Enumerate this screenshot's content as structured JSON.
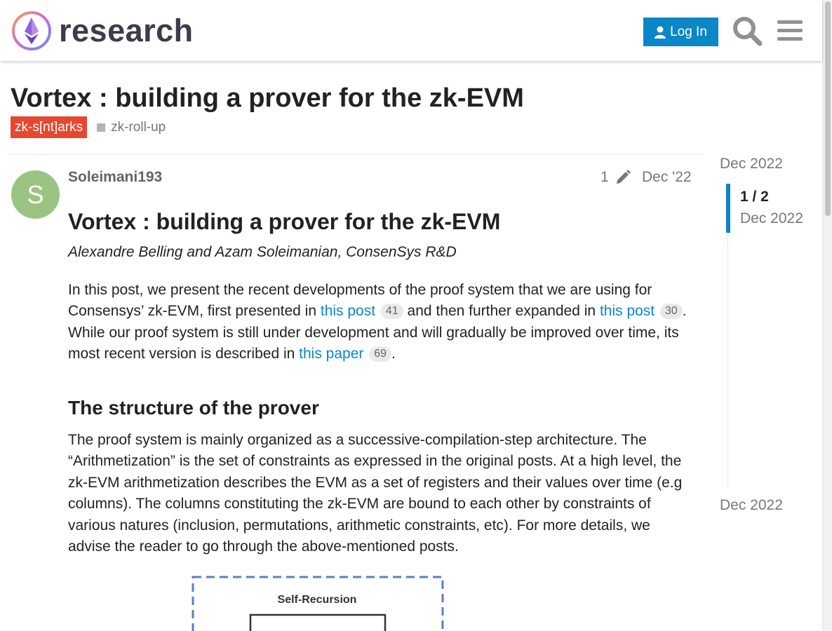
{
  "header": {
    "logo_text": "research",
    "login_label": "Log In",
    "accent_color": "#0b86c6"
  },
  "topic": {
    "title": "Vortex : building a prover for the zk-EVM",
    "category": "zk-s[nt]arks",
    "category_color": "#e8472f",
    "tag": "zk-roll-up"
  },
  "post": {
    "avatar_letter": "S",
    "avatar_color": "#9bc482",
    "username": "Soleimani193",
    "edit_count": "1",
    "date": "Dec '22",
    "heading": "Vortex : building a prover for the zk-EVM",
    "authors": "Alexandre Belling and Azam Soleimanian, ConsenSys R&D",
    "intro": {
      "t1": "In this post, we present the recent developments of the proof system that we are using for Consensys’ zk-EVM, first presented in ",
      "link1": "this post",
      "link1_clicks": "41",
      "t2": " and then further expanded in ",
      "link2": "this post",
      "link2_clicks": "30",
      "t3": ". While our proof system is still under development and will gradually be improved over time, its most recent version is described in ",
      "link3": "this paper",
      "link3_clicks": "69",
      "t4": "."
    },
    "section_heading": "The structure of the prover",
    "section_text": "The proof system is mainly organized as a successive-compilation-step architecture. The “Arithmetization” is the set of constraints as expressed in the original posts. At a high level, the zk-EVM arithmetization describes the EVM as a set of registers and their values over time (e.g columns). The columns constituting the zk-EVM are bound to each other by constraints of various natures (inclusion, permutations, arithmetic constraints, etc). For more details, we advise the reader to go through the above-mentioned posts.",
    "diagram_label": "Self-Recursion"
  },
  "timeline": {
    "top_date": "Dec 2022",
    "position": "1 / 2",
    "position_date": "Dec 2022",
    "bottom_date": "Dec 2022"
  }
}
